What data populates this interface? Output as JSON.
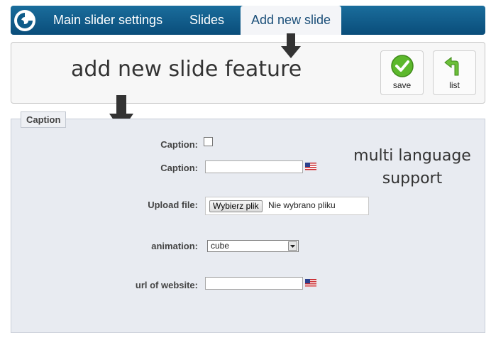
{
  "nav": {
    "items": [
      {
        "label": "Main slider settings"
      },
      {
        "label": "Slides"
      },
      {
        "label": "Add new slide"
      }
    ]
  },
  "toolbar": {
    "annotation": "add new slide feature",
    "save_label": "save",
    "list_label": "list"
  },
  "form": {
    "legend": "Caption",
    "caption_checkbox_label": "Caption:",
    "caption_text_label": "Caption:",
    "caption_text_value": "",
    "upload_label": "Upload file:",
    "file_button_label": "Wybierz plik",
    "file_status": "Nie wybrano pliku",
    "animation_label": "animation:",
    "animation_value": "cube",
    "url_label": "url of website:",
    "url_value": ""
  },
  "annotations": {
    "multi_language": [
      "multi language",
      "support"
    ]
  },
  "colors": {
    "nav_bg": "#0a4d7a",
    "active_tab_bg": "#f4f5f8",
    "form_bg": "#e8ebf1",
    "save_green": "#5cb82c",
    "list_green": "#6cbf3a"
  },
  "icons": [
    "logo-icon",
    "save-check-icon",
    "list-return-arrow-icon",
    "us-flag-icon",
    "down-arrow-annotation",
    "left-arrow-annotation"
  ]
}
